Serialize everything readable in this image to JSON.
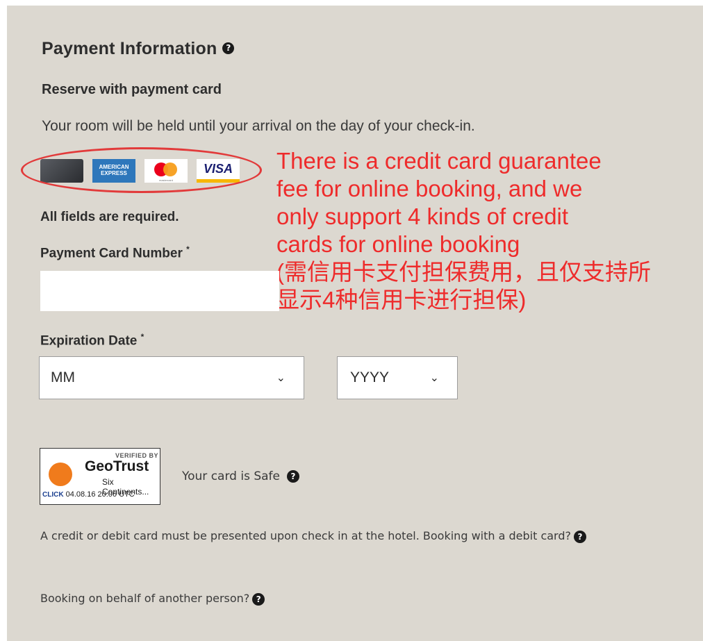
{
  "section": {
    "title": "Payment Information",
    "subtitle": "Reserve with payment card",
    "description": "Your room will be held until your arrival on the day of your check-in."
  },
  "cards": {
    "amex_text_1": "AMERICAN",
    "amex_text_2": "EXPRESS",
    "mastercard_text": "mastercard",
    "visa_text": "VISA"
  },
  "annotation": {
    "line1": "There is a credit card guarantee",
    "line2": "fee for online booking, and we",
    "line3": "only support 4 kinds of credit",
    "line4": "cards for online booking",
    "line5": "(需信用卡支付担保费用，且仅支持所",
    "line6": "显示4种信用卡进行担保)"
  },
  "form": {
    "required_note": "All fields are required.",
    "card_number_label": "Payment Card Number",
    "card_number_value": "",
    "expiration_label": "Expiration Date",
    "required_marker": "*",
    "month_value": "MM",
    "year_value": "YYYY"
  },
  "geotrust": {
    "verified": "VERIFIED BY",
    "brand": "GeoTrust",
    "owner": "Six Continents...",
    "click": "CLICK",
    "timestamp": "04.08.16 20:06 UTC"
  },
  "footer": {
    "safe_text": "Your card is Safe",
    "debit_text": "A credit or debit card must be presented upon check in at the hotel. Booking with a debit card?",
    "behalf_text": "Booking on behalf of another person?",
    "help_glyph": "?"
  },
  "colors": {
    "panel_bg": "#dcd8d0",
    "annotation": "#ee2b2b"
  }
}
